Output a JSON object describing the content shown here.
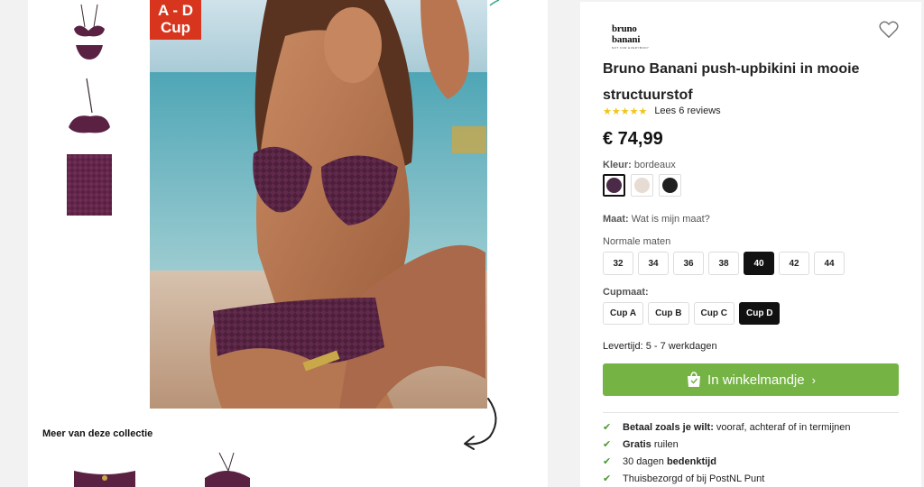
{
  "gallery": {
    "cup_badge_line1": "A - D",
    "cup_badge_line2": "Cup",
    "collection_title": "Meer van deze collectie"
  },
  "product": {
    "brand_name": "bruno banani",
    "brand_tagline": "NOT FOR EVERYBODY",
    "title": "Bruno Banani push-upbikini in mooie structuurstof",
    "stars": "★★★★★",
    "reviews_link": "Lees 6 reviews",
    "rating_value": 4.5,
    "price": "€ 74,99"
  },
  "colour": {
    "label": "Kleur:",
    "value": "bordeaux",
    "swatches": [
      {
        "name": "bordeaux",
        "hex": "#4b2a47"
      },
      {
        "name": "beige",
        "hex": "#e6dcd3"
      },
      {
        "name": "zwart",
        "hex": "#1f1f1f"
      }
    ]
  },
  "size": {
    "label": "Maat:",
    "help_link": "Wat is mijn maat?",
    "group_label": "Normale maten",
    "options": [
      "32",
      "34",
      "36",
      "38",
      "40",
      "42",
      "44"
    ],
    "selected": "40"
  },
  "cup": {
    "label": "Cupmaat:",
    "options": [
      "Cup A",
      "Cup B",
      "Cup C",
      "Cup D"
    ],
    "selected": "Cup D"
  },
  "delivery": "Levertijd: 5 - 7 werkdagen",
  "cart": {
    "label": "In winkelmandje",
    "chevron": "›"
  },
  "usps": [
    {
      "bold": "Betaal zoals je wilt:",
      "text": " vooraf, achteraf of in termijnen"
    },
    {
      "bold": "Gratis",
      "text": " ruilen"
    },
    {
      "pre": "30 dagen ",
      "bold": "bedenktijd",
      "text": ""
    },
    {
      "pre": "Thuisbezorgd of bij PostNL Punt",
      "bold": "",
      "text": ""
    }
  ],
  "colors": {
    "accent_green": "#75b345",
    "badge_red": "#d8351e",
    "check_green": "#4a9a2e"
  }
}
